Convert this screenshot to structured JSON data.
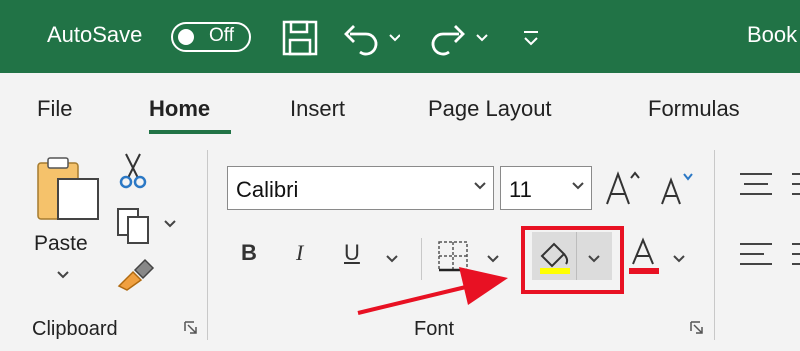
{
  "titlebar": {
    "autosave_label": "AutoSave",
    "autosave_state": "Off",
    "title": "Book",
    "icons": [
      "save-icon",
      "undo-icon",
      "redo-icon",
      "customize-qat-icon"
    ],
    "background": "#217346"
  },
  "tabs": [
    {
      "label": "File"
    },
    {
      "label": "Home",
      "active": true
    },
    {
      "label": "Insert"
    },
    {
      "label": "Page Layout"
    },
    {
      "label": "Formulas"
    }
  ],
  "clipboard": {
    "paste_label": "Paste",
    "group_label": "Clipboard",
    "icons": [
      "paste-icon",
      "cut-icon",
      "copy-icon",
      "format-painter-icon"
    ]
  },
  "font": {
    "font_name": "Calibri",
    "font_size": "11",
    "bold": "B",
    "italic": "I",
    "underline": "U",
    "group_label": "Font",
    "highlight_color": "#ffff00",
    "font_color": "#e81123",
    "icons": [
      "increase-font-size-icon",
      "decrease-font-size-icon",
      "borders-icon",
      "fill-color-icon",
      "font-color-icon"
    ]
  },
  "annotation": {
    "box_color": "#e81123",
    "arrow_color": "#e81123"
  }
}
